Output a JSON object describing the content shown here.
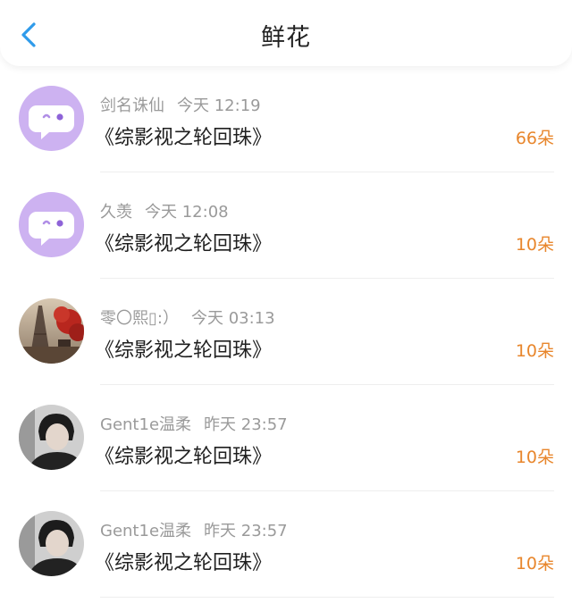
{
  "header": {
    "title": "鲜花",
    "back_icon": "chevron-left-icon",
    "accent_color": "#2f9bea"
  },
  "colors": {
    "amount": "#e8862c",
    "meta": "#9a9a9a",
    "default_avatar_bg": "#cdb2f1"
  },
  "items": [
    {
      "user": "剑名诛仙",
      "time": "今天 12:19",
      "book": "《综影视之轮回珠》",
      "amount": "66朵",
      "avatar": "default-chat-avatar"
    },
    {
      "user": "久羡",
      "time": "今天 12:08",
      "book": "《综影视之轮回珠》",
      "amount": "10朵",
      "avatar": "default-chat-avatar"
    },
    {
      "user": "零〇熙▯:）",
      "time": "今天 03:13",
      "book": "《综影视之轮回珠》",
      "amount": "10朵",
      "avatar": "eiffel-tower-photo"
    },
    {
      "user": "Gent1e温柔",
      "time": "昨天 23:57",
      "book": "《综影视之轮回珠》",
      "amount": "10朵",
      "avatar": "person-photo"
    },
    {
      "user": "Gent1e温柔",
      "time": "昨天 23:57",
      "book": "《综影视之轮回珠》",
      "amount": "10朵",
      "avatar": "person-photo"
    }
  ]
}
